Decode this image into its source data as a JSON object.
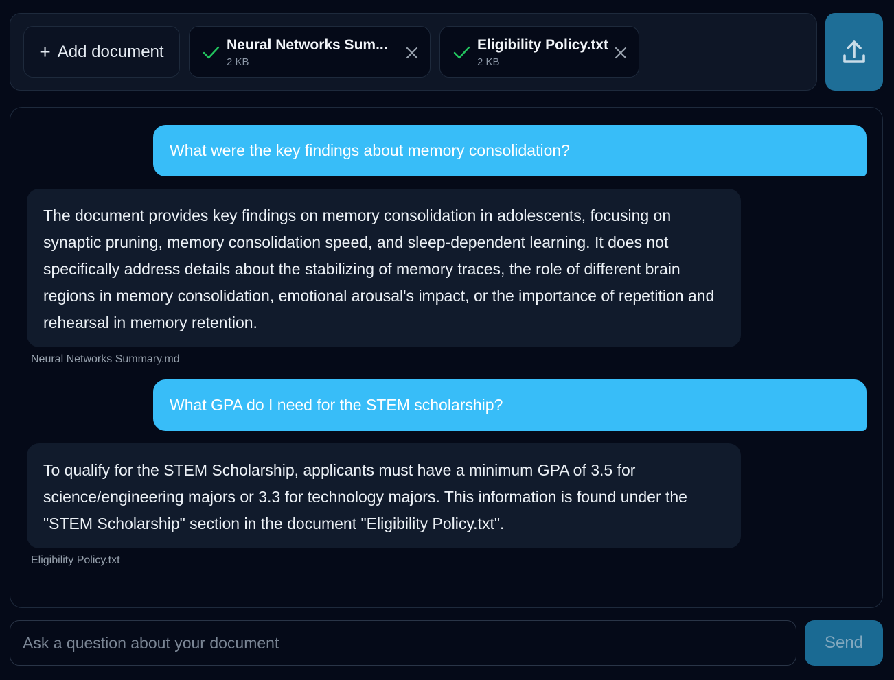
{
  "header": {
    "add_document_label": "Add document",
    "documents": [
      {
        "name": "Neural Networks Sum...",
        "size": "2 KB",
        "status": "uploaded"
      },
      {
        "name": "Eligibility Policy.txt",
        "size": "2 KB",
        "status": "uploaded"
      }
    ],
    "upload_icon": "upload-icon"
  },
  "chat": {
    "messages": [
      {
        "role": "user",
        "text": "What were the key findings about memory consolidation?"
      },
      {
        "role": "assistant",
        "text": "The document provides key findings on memory consolidation in adolescents, focusing on synaptic pruning, memory consolidation speed, and sleep-dependent learning. It does not specifically address details about the stabilizing of memory traces, the role of different brain regions in memory consolidation, emotional arousal's impact, or the importance of repetition and rehearsal in memory retention.",
        "source": "Neural Networks Summary.md"
      },
      {
        "role": "user",
        "text": "What GPA do I need for the STEM scholarship?"
      },
      {
        "role": "assistant",
        "text": "To qualify for the STEM Scholarship, applicants must have a minimum GPA of 3.5 for science/engineering majors or 3.3 for technology majors. This information is found under the \"STEM Scholarship\" section in the document \"Eligibility Policy.txt\".",
        "source": "Eligibility Policy.txt"
      }
    ]
  },
  "composer": {
    "placeholder": "Ask a question about your document",
    "value": "",
    "send_label": "Send"
  },
  "colors": {
    "background": "#050a18",
    "user_bubble": "#38bdf8",
    "assistant_bubble": "#111b2c",
    "accent_button": "#1e6e97",
    "check_green": "#22c55e"
  }
}
